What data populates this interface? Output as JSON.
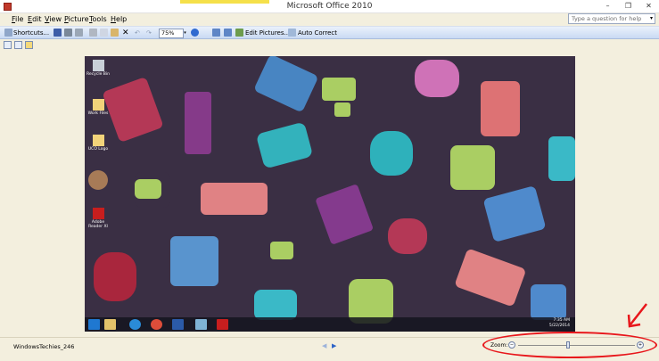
{
  "window": {
    "title": "Microsoft Office 2010",
    "controls": {
      "minimize": "–",
      "restore": "❐",
      "close": "✕"
    }
  },
  "menu": {
    "items": [
      "File",
      "Edit",
      "View",
      "Picture",
      "Tools",
      "Help"
    ],
    "help_placeholder": "Type a question for help"
  },
  "toolbar": {
    "shortcuts_label": "Shortcuts...",
    "zoom_value": "75%",
    "edit_pictures_label": "Edit Pictures...",
    "auto_correct_label": "Auto Correct"
  },
  "desktop": {
    "icons": [
      {
        "label": "Recycle Bin",
        "icon": "recycle-bin-icon"
      },
      {
        "label": "Work Files",
        "icon": "folder-icon"
      },
      {
        "label": "UCO Logo",
        "icon": "folder-icon"
      },
      {
        "label": "",
        "icon": "user-photo-icon"
      },
      {
        "label": "Adobe Reader XI",
        "icon": "adobe-reader-icon"
      }
    ],
    "tray_time": "7:35 AM",
    "tray_date": "5/22/2014"
  },
  "status": {
    "filename": "WindowsTechies_246",
    "zoom_label": "Zoom:",
    "zoom_level": 0.43
  },
  "colors": {
    "annotation": "#e8161b",
    "toolbar_top": "#eaf1fb",
    "toolbar_bottom": "#c9daf3",
    "background": "#f3efde"
  }
}
